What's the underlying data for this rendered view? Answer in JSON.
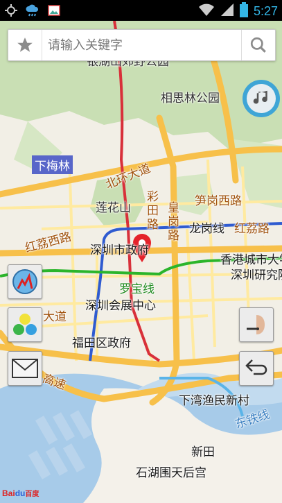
{
  "status_bar": {
    "time": "5:27",
    "icons": [
      "gps-icon",
      "weather-icon",
      "gallery-icon",
      "wifi-icon",
      "signal-icon",
      "battery-icon"
    ]
  },
  "search": {
    "placeholder": "请输入关键字",
    "favorite_icon": "star-icon",
    "search_icon": "magnifier-icon"
  },
  "map_labels": {
    "park_top": "银湖山郊野公园",
    "park": "相思林公园",
    "xiameilin": "下梅林",
    "beihuan": "北环大道",
    "lianhuashan": "莲花山",
    "caitian": "彩田路",
    "huanggang": "皇岗路",
    "sungang": "笋岗西路",
    "honglixi": "红荔西路",
    "longgang_line": "龙岗线",
    "hongli_road": "红荔路",
    "civic_center": "深圳市政府",
    "hk_city": "香港城市大学",
    "research": "深圳研究院",
    "luobao_line": "罗宝线",
    "expo": "深圳会展中心",
    "futian_gov": "福田区政府",
    "road_dao": "大道",
    "road_gao": "高速",
    "xiawan": "下湾渔民新村",
    "dongtie": "东铁线",
    "xintian": "新田",
    "shihu": "石湖围天后宫"
  },
  "buttons": {
    "music": "music-note-icon",
    "route": "route-arrows-icon",
    "layers": "layers-icon",
    "message": "envelope-icon",
    "voice": "voice-assistant-icon",
    "back": "back-arrow-icon"
  },
  "logo": {
    "text_bai": "Bai",
    "text_du": "du",
    "text_cn": "百度"
  },
  "colors": {
    "water": "#a7cbe9",
    "green": "#c9dfb4",
    "land": "#f2efe6",
    "major_road": "#f7c04a",
    "minor_road": "#ffeaa0",
    "metro_red": "#d8303a",
    "metro_blue": "#2f5bd0",
    "metro_green": "#2bb52b",
    "marker": "#e4222a",
    "accent": "#33b5e5"
  }
}
